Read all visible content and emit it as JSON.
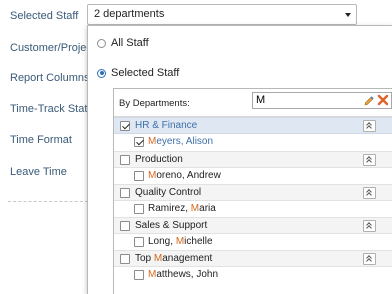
{
  "sidebar": {
    "labels": [
      "Selected Staff",
      "Customer/Project",
      "Report Columns",
      "Time-Track Status",
      "Time Format",
      "Leave Time"
    ]
  },
  "staff_select": {
    "value": "2 departments"
  },
  "panel": {
    "radio_all": "All Staff",
    "radio_selected": "Selected Staff",
    "selected_option": "Selected Staff",
    "by_departments_label": "By Departments:",
    "filter_value": "M",
    "departments": [
      {
        "name": "HR & Finance",
        "checked": true,
        "highlighted": true,
        "members": [
          {
            "pre": "",
            "match": "M",
            "post": "eyers, Alison",
            "checked": true
          }
        ]
      },
      {
        "name": "Production",
        "checked": false,
        "members": [
          {
            "pre": "",
            "match": "M",
            "post": "oreno, Andrew",
            "checked": false
          }
        ]
      },
      {
        "name": "Quality Control",
        "checked": false,
        "members": [
          {
            "pre": "Ramirez, ",
            "match": "M",
            "post": "aria",
            "checked": false
          }
        ]
      },
      {
        "name": "Sales & Support",
        "checked": false,
        "members": [
          {
            "pre": "Long, ",
            "match": "M",
            "post": "ichelle",
            "checked": false
          }
        ]
      },
      {
        "name": "Top Management",
        "name_pre": "Top ",
        "name_match": "M",
        "name_post": "anagement",
        "checked": false,
        "members": [
          {
            "pre": "",
            "match": "M",
            "post": "atthews, John",
            "checked": false
          }
        ]
      }
    ]
  },
  "colors": {
    "accent": "#2f6fb3",
    "match_highlight": "#d5681e",
    "label": "#3a5a78"
  }
}
